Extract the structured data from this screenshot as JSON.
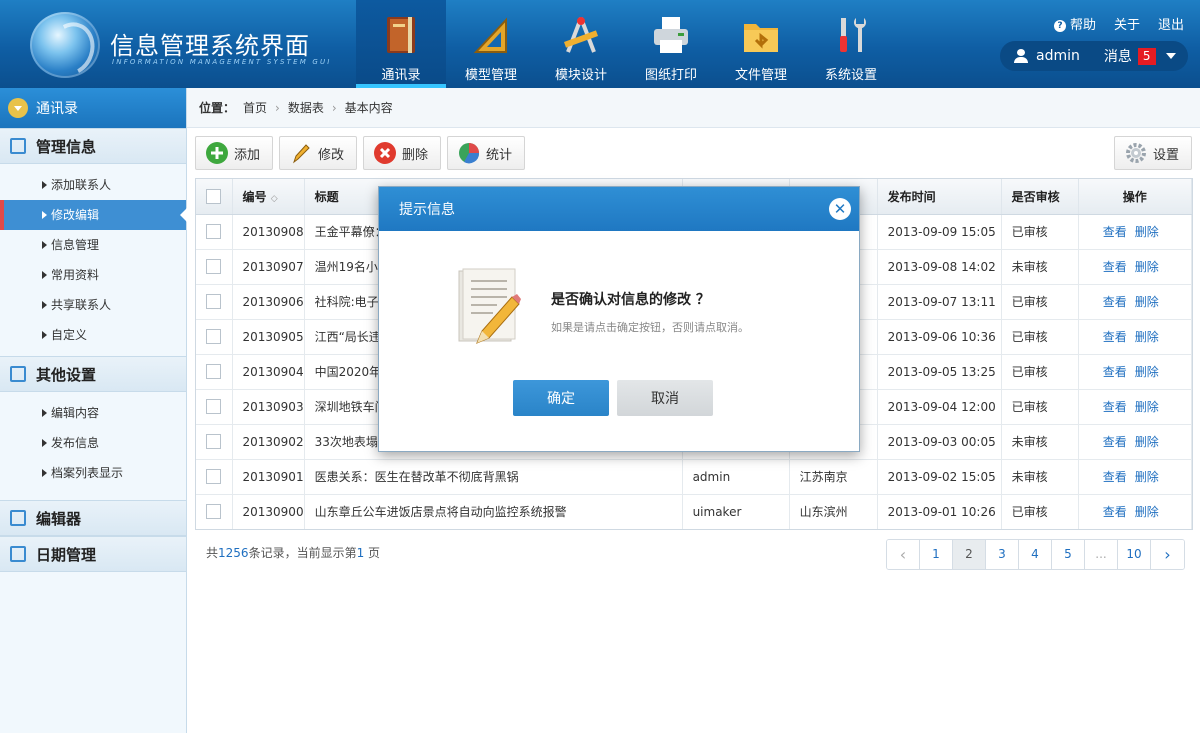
{
  "header": {
    "title": "信息管理系统界面",
    "subtitle": "INFORMATION MANAGEMENT SYSTEM GUI",
    "nav": [
      {
        "label": "通讯录",
        "icon": "book-icon",
        "active": true
      },
      {
        "label": "模型管理",
        "icon": "ruler-triangle-icon"
      },
      {
        "label": "模块设计",
        "icon": "compass-icon"
      },
      {
        "label": "图纸打印",
        "icon": "printer-icon"
      },
      {
        "label": "文件管理",
        "icon": "folder-icon"
      },
      {
        "label": "系统设置",
        "icon": "tools-icon"
      }
    ],
    "links": {
      "help": "帮助",
      "about": "关于",
      "logout": "退出"
    },
    "user": {
      "name": "admin",
      "messages_label": "消息",
      "messages_count": "5"
    }
  },
  "sidebar": {
    "top": "通讯录",
    "groups": [
      {
        "title": "管理信息",
        "items": [
          "添加联系人",
          "修改编辑",
          "信息管理",
          "常用资料",
          "共享联系人",
          "自定义"
        ],
        "active_index": 1
      },
      {
        "title": "其他设置",
        "items": [
          "编辑内容",
          "发布信息",
          "档案列表显示"
        ]
      },
      {
        "title": "编辑器",
        "items": []
      },
      {
        "title": "日期管理",
        "items": []
      }
    ]
  },
  "breadcrumb": {
    "label": "位置：",
    "items": [
      "首页",
      "数据表",
      "基本内容"
    ]
  },
  "toolbar": {
    "add": "添加",
    "edit": "修改",
    "delete": "删除",
    "stats": "统计",
    "settings": "设置"
  },
  "table": {
    "headers": {
      "id": "编号",
      "title": "标题",
      "author": "",
      "place": "",
      "time": "发布时间",
      "status": "是否审核",
      "ops": "操作"
    },
    "view_label": "查看",
    "delete_label": "删除",
    "rows": [
      {
        "id": "20130908",
        "title": "王金平幕僚：",
        "author": "",
        "place": "",
        "time": "2013-09-09 15:05",
        "status": "已审核"
      },
      {
        "id": "20130907",
        "title": "温州19名小学",
        "author": "",
        "place": "",
        "time": "2013-09-08 14:02",
        "status": "未审核"
      },
      {
        "id": "20130906",
        "title": "社科院:电子",
        "author": "",
        "place": "",
        "time": "2013-09-07 13:11",
        "status": "已审核"
      },
      {
        "id": "20130905",
        "title": "江西“局长违",
        "author": "",
        "place": "",
        "time": "2013-09-06 10:36",
        "status": "已审核"
      },
      {
        "id": "20130904",
        "title": "中国2020年现",
        "author": "",
        "place": "",
        "time": "2013-09-05 13:25",
        "status": "已审核"
      },
      {
        "id": "20130903",
        "title": "深圳地铁车门",
        "author": "",
        "place": "",
        "time": "2013-09-04 12:00",
        "status": "已审核"
      },
      {
        "id": "20130902",
        "title": "33次地表塌陷",
        "author": "",
        "place": "",
        "time": "2013-09-03 00:05",
        "status": "未审核"
      },
      {
        "id": "20130901",
        "title": "医患关系：医生在替改革不彻底背黑锅",
        "author": "admin",
        "place": "江苏南京",
        "time": "2013-09-02 15:05",
        "status": "未审核"
      },
      {
        "id": "20130900",
        "title": "山东章丘公车进饭店景点将自动向监控系统报警",
        "author": "uimaker",
        "place": "山东滨州",
        "time": "2013-09-01 10:26",
        "status": "已审核"
      }
    ]
  },
  "footer": {
    "prefix": "共",
    "count": "1256",
    "middle": "条记录，当前显示第",
    "page": "1",
    "suffix": "页"
  },
  "pager": {
    "prev": "‹",
    "pages": [
      "1",
      "2",
      "3",
      "4",
      "5",
      "...",
      "10"
    ],
    "next": "›",
    "current": "2"
  },
  "modal": {
    "title": "提示信息",
    "question": "是否确认对信息的修改 ？",
    "hint": "如果是请点击确定按钮，否则请点取消。",
    "ok": "确定",
    "cancel": "取消"
  }
}
